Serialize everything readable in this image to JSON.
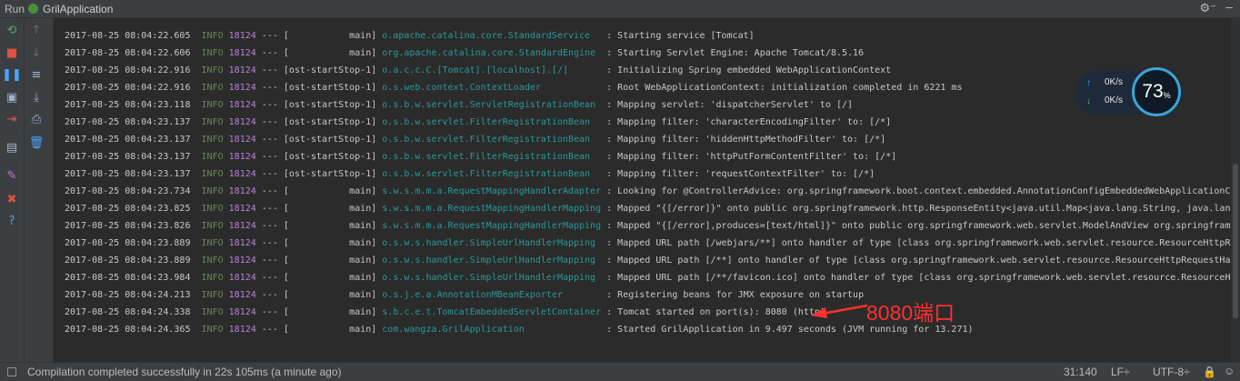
{
  "titlebar": {
    "run_label": "Run",
    "app_name": "GrilApplication",
    "gear_icon": "⚙⁻",
    "minimize_icon": "–"
  },
  "toolbar_left": [
    {
      "name": "rerun-icon",
      "glyph": "⟲",
      "color": "#59a869"
    },
    {
      "name": "stop-icon",
      "glyph": "■",
      "color": "#e0513f"
    },
    {
      "name": "pause-icon",
      "glyph": "❚❚",
      "color": "#4aa3ff"
    },
    {
      "name": "camera-icon",
      "glyph": "▣",
      "color": "#9fb3c8"
    },
    {
      "name": "login-icon",
      "glyph": "⇥",
      "color": "#e05a4a"
    },
    {
      "name": "layout-icon",
      "glyph": "▤",
      "color": "#9fb3c8"
    },
    {
      "name": "pin-icon",
      "glyph": "✎",
      "color": "#b877d9"
    },
    {
      "name": "close-icon",
      "glyph": "✖",
      "color": "#e0513f"
    },
    {
      "name": "help-icon",
      "glyph": "?",
      "color": "#4aa3ff"
    }
  ],
  "toolbar_right": [
    {
      "name": "up-arrow-icon",
      "glyph": "↑",
      "color": "#6b6b6b"
    },
    {
      "name": "down-arrow-icon",
      "glyph": "↓",
      "color": "#6b6b6b"
    },
    {
      "name": "wrap-icon",
      "glyph": "≡",
      "color": "#9fb3c8"
    },
    {
      "name": "scroll-to-end-icon",
      "glyph": "⤓",
      "color": "#9fb3c8"
    },
    {
      "name": "print-icon",
      "glyph": "⎙",
      "color": "#9fb3c8"
    },
    {
      "name": "trash-icon",
      "glyph": "🗑",
      "color": "#4aa3ff"
    }
  ],
  "log_lines": [
    {
      "ts": "2017-08-25 08:04:22.605",
      "lvl": "INFO",
      "pid": "18124",
      "sep": "---",
      "thr": "[           main]",
      "log": "o.apache.catalina.core.StandardService  ",
      "msg": "Starting service [Tomcat]"
    },
    {
      "ts": "2017-08-25 08:04:22.606",
      "lvl": "INFO",
      "pid": "18124",
      "sep": "---",
      "thr": "[           main]",
      "log": "org.apache.catalina.core.StandardEngine ",
      "msg": "Starting Servlet Engine: Apache Tomcat/8.5.16"
    },
    {
      "ts": "2017-08-25 08:04:22.916",
      "lvl": "INFO",
      "pid": "18124",
      "sep": "---",
      "thr": "[ost-startStop-1]",
      "log": "o.a.c.c.C.[Tomcat].[localhost].[/]      ",
      "msg": "Initializing Spring embedded WebApplicationContext"
    },
    {
      "ts": "2017-08-25 08:04:22.916",
      "lvl": "INFO",
      "pid": "18124",
      "sep": "---",
      "thr": "[ost-startStop-1]",
      "log": "o.s.web.context.ContextLoader           ",
      "msg": "Root WebApplicationContext: initialization completed in 6221 ms"
    },
    {
      "ts": "2017-08-25 08:04:23.118",
      "lvl": "INFO",
      "pid": "18124",
      "sep": "---",
      "thr": "[ost-startStop-1]",
      "log": "o.s.b.w.servlet.ServletRegistrationBean ",
      "msg": "Mapping servlet: 'dispatcherServlet' to [/]"
    },
    {
      "ts": "2017-08-25 08:04:23.137",
      "lvl": "INFO",
      "pid": "18124",
      "sep": "---",
      "thr": "[ost-startStop-1]",
      "log": "o.s.b.w.servlet.FilterRegistrationBean  ",
      "msg": "Mapping filter: 'characterEncodingFilter' to: [/*]"
    },
    {
      "ts": "2017-08-25 08:04:23.137",
      "lvl": "INFO",
      "pid": "18124",
      "sep": "---",
      "thr": "[ost-startStop-1]",
      "log": "o.s.b.w.servlet.FilterRegistrationBean  ",
      "msg": "Mapping filter: 'hiddenHttpMethodFilter' to: [/*]"
    },
    {
      "ts": "2017-08-25 08:04:23.137",
      "lvl": "INFO",
      "pid": "18124",
      "sep": "---",
      "thr": "[ost-startStop-1]",
      "log": "o.s.b.w.servlet.FilterRegistrationBean  ",
      "msg": "Mapping filter: 'httpPutFormContentFilter' to: [/*]"
    },
    {
      "ts": "2017-08-25 08:04:23.137",
      "lvl": "INFO",
      "pid": "18124",
      "sep": "---",
      "thr": "[ost-startStop-1]",
      "log": "o.s.b.w.servlet.FilterRegistrationBean  ",
      "msg": "Mapping filter: 'requestContextFilter' to: [/*]"
    },
    {
      "ts": "2017-08-25 08:04:23.734",
      "lvl": "INFO",
      "pid": "18124",
      "sep": "---",
      "thr": "[           main]",
      "log": "s.w.s.m.m.a.RequestMappingHandlerAdapter",
      "msg": "Looking for @ControllerAdvice: org.springframework.boot.context.embedded.AnnotationConfigEmbeddedWebApplicationContext"
    },
    {
      "ts": "2017-08-25 08:04:23.825",
      "lvl": "INFO",
      "pid": "18124",
      "sep": "---",
      "thr": "[           main]",
      "log": "s.w.s.m.m.a.RequestMappingHandlerMapping",
      "msg": "Mapped \"{[/error]}\" onto public org.springframework.http.ResponseEntity<java.util.Map<java.lang.String, java.lang.Object>>"
    },
    {
      "ts": "2017-08-25 08:04:23.826",
      "lvl": "INFO",
      "pid": "18124",
      "sep": "---",
      "thr": "[           main]",
      "log": "s.w.s.m.m.a.RequestMappingHandlerMapping",
      "msg": "Mapped \"{[/error],produces=[text/html]}\" onto public org.springframework.web.servlet.ModelAndView org.springframework"
    },
    {
      "ts": "2017-08-25 08:04:23.889",
      "lvl": "INFO",
      "pid": "18124",
      "sep": "---",
      "thr": "[           main]",
      "log": "o.s.w.s.handler.SimpleUrlHandlerMapping ",
      "msg": "Mapped URL path [/webjars/**] onto handler of type [class org.springframework.web.servlet.resource.ResourceHttpRequestHandler]"
    },
    {
      "ts": "2017-08-25 08:04:23.889",
      "lvl": "INFO",
      "pid": "18124",
      "sep": "---",
      "thr": "[           main]",
      "log": "o.s.w.s.handler.SimpleUrlHandlerMapping ",
      "msg": "Mapped URL path [/**] onto handler of type [class org.springframework.web.servlet.resource.ResourceHttpRequestHandler]"
    },
    {
      "ts": "2017-08-25 08:04:23.984",
      "lvl": "INFO",
      "pid": "18124",
      "sep": "---",
      "thr": "[           main]",
      "log": "o.s.w.s.handler.SimpleUrlHandlerMapping ",
      "msg": "Mapped URL path [/**/favicon.ico] onto handler of type [class org.springframework.web.servlet.resource.ResourceHttpRequestHandler]"
    },
    {
      "ts": "2017-08-25 08:04:24.213",
      "lvl": "INFO",
      "pid": "18124",
      "sep": "---",
      "thr": "[           main]",
      "log": "o.s.j.e.a.AnnotationMBeanExporter       ",
      "msg": "Registering beans for JMX exposure on startup"
    },
    {
      "ts": "2017-08-25 08:04:24.338",
      "lvl": "INFO",
      "pid": "18124",
      "sep": "---",
      "thr": "[           main]",
      "log": "s.b.c.e.t.TomcatEmbeddedServletContainer",
      "msg": "Tomcat started on port(s): 8080 (http)"
    },
    {
      "ts": "2017-08-25 08:04:24.365",
      "lvl": "INFO",
      "pid": "18124",
      "sep": "---",
      "thr": "[           main]",
      "log": "com.wangza.GrilApplication              ",
      "msg": "Started GrilApplication in 9.497 seconds (JVM running for 13.271)"
    }
  ],
  "net_widget": {
    "up_arrow": "↑",
    "up_value": "0K/s",
    "down_arrow": "↓",
    "down_value": "0K/s",
    "percent": "73",
    "percent_sign": "%"
  },
  "annotation": {
    "text": "8080端口",
    "color": "#ff3030"
  },
  "statusbar": {
    "message": "Compilation completed successfully in 22s 105ms (a minute ago)",
    "position": "31:140",
    "line_ending": "LF÷",
    "encoding": "UTF-8÷",
    "lock_icon": "🔒",
    "face_icon": "☺"
  }
}
